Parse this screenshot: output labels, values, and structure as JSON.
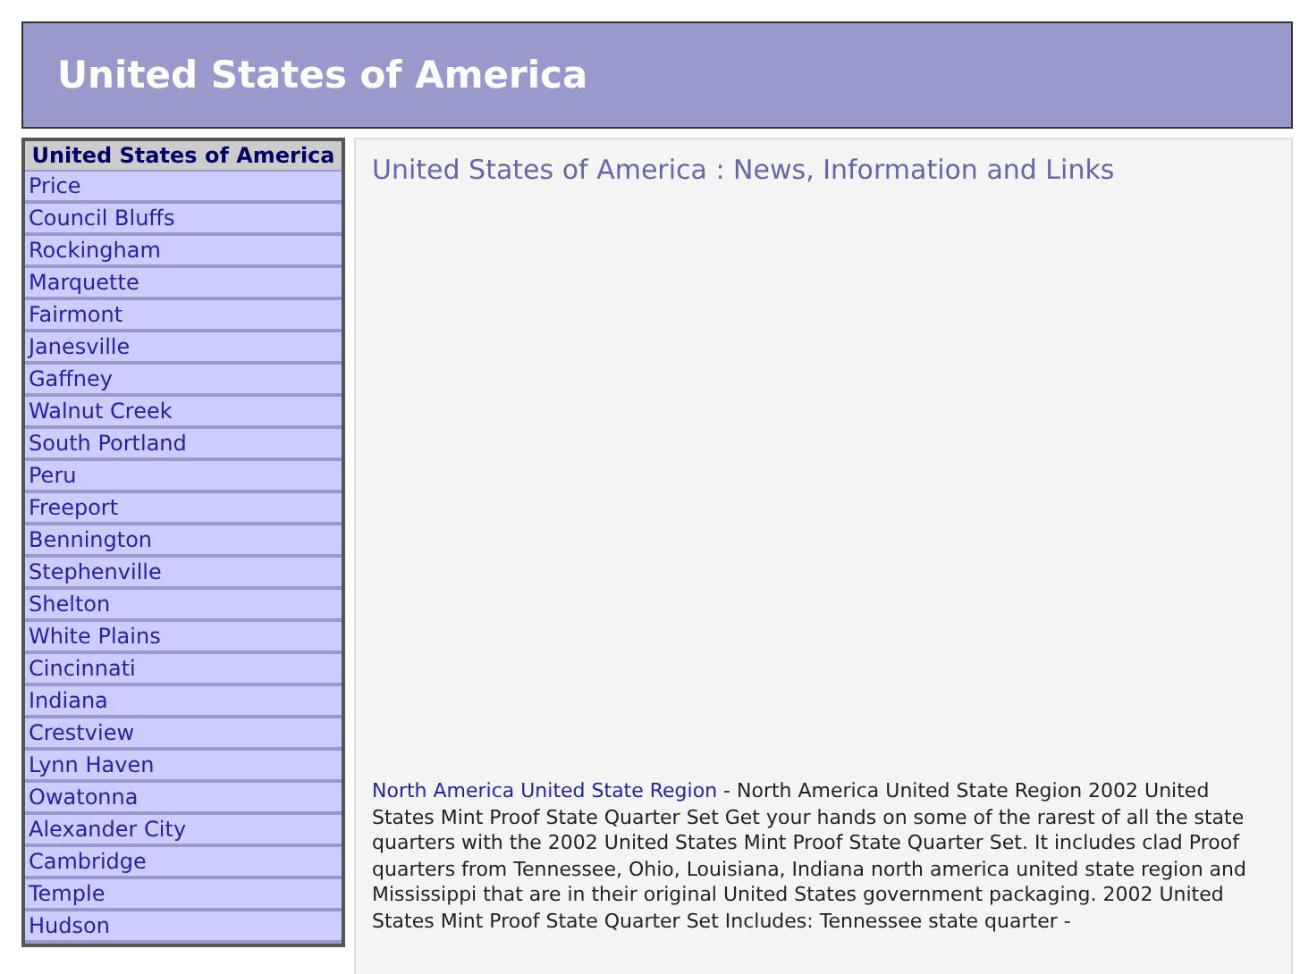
{
  "header": {
    "title": "United States of America"
  },
  "sidebar": {
    "title": "United States of America",
    "items": [
      "Price",
      "Council Bluffs",
      "Rockingham",
      "Marquette",
      "Fairmont",
      "Janesville",
      "Gaffney",
      "Walnut Creek",
      "South Portland",
      "Peru",
      "Freeport",
      "Bennington",
      "Stephenville",
      "Shelton",
      "White Plains",
      "Cincinnati",
      "Indiana",
      "Crestview",
      "Lynn Haven",
      "Owatonna",
      "Alexander City",
      "Cambridge",
      "Temple",
      "Hudson"
    ]
  },
  "content": {
    "heading": "United States of America : News, Information and Links",
    "entry": {
      "link": "North America United State Region",
      "text": " - North America United State Region 2002 United States Mint Proof State Quarter Set Get your hands on some of the rarest of all the state quarters with the 2002 United States Mint Proof State Quarter Set. It includes clad Proof quarters from Tennessee, Ohio, Louisiana, Indiana north america united state region and Mississippi that are in their original United States government packaging. 2002 United States Mint Proof State Quarter Set Includes: Tennessee state quarter -"
    }
  }
}
